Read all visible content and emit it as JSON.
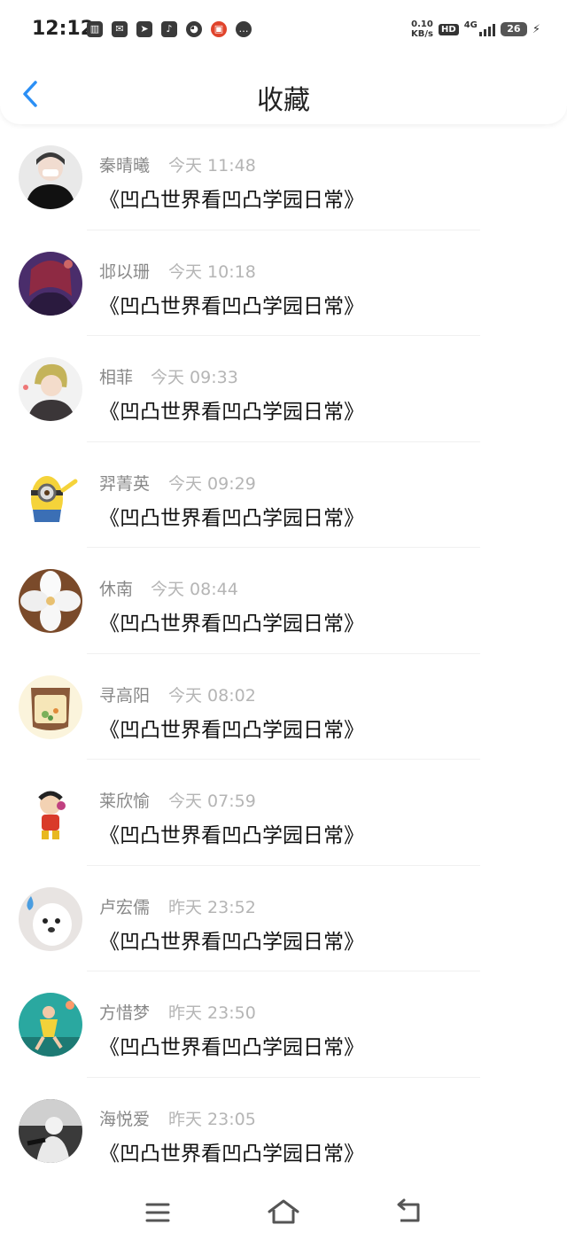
{
  "status_bar": {
    "time": "12:12",
    "speed_value": "0.10",
    "speed_unit": "KB/s",
    "hd": "HD",
    "network": "4G",
    "battery": "26"
  },
  "header": {
    "title": "收藏"
  },
  "items": [
    {
      "name": "秦晴曦",
      "time": "今天 11:48",
      "message": "《凹凸世界看凹凸学园日常》"
    },
    {
      "name": "邶以珊",
      "time": "今天 10:18",
      "message": "《凹凸世界看凹凸学园日常》"
    },
    {
      "name": "相菲",
      "time": "今天 09:33",
      "message": "《凹凸世界看凹凸学园日常》"
    },
    {
      "name": "羿菁英",
      "time": "今天 09:29",
      "message": "《凹凸世界看凹凸学园日常》"
    },
    {
      "name": "休南",
      "time": "今天 08:44",
      "message": "《凹凸世界看凹凸学园日常》"
    },
    {
      "name": "寻高阳",
      "time": "今天 08:02",
      "message": "《凹凸世界看凹凸学园日常》"
    },
    {
      "name": "莱欣愉",
      "time": "今天 07:59",
      "message": "《凹凸世界看凹凸学园日常》"
    },
    {
      "name": "卢宏儒",
      "time": "昨天 23:52",
      "message": "《凹凸世界看凹凸学园日常》"
    },
    {
      "name": "方惜梦",
      "time": "昨天 23:50",
      "message": "《凹凸世界看凹凸学园日常》"
    },
    {
      "name": "海悦爱",
      "time": "昨天 23:05",
      "message": "《凹凸世界看凹凸学园日常》"
    }
  ]
}
